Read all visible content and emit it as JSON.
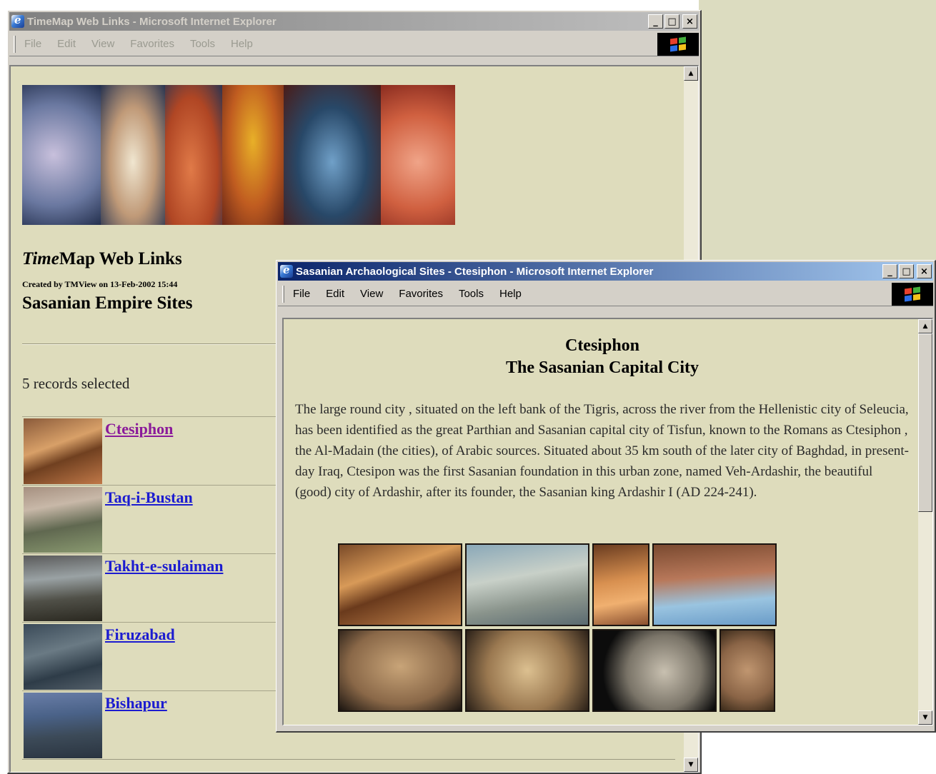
{
  "colors": {
    "page_background": "#dedcbc",
    "link": "#1c1cd0",
    "visited_link": "#8a1a9a",
    "active_title": "#0a246a",
    "inactive_title": "#808080"
  },
  "window_back": {
    "title": "TimeMap Web Links - Microsoft Internet Explorer",
    "menu": [
      "File",
      "Edit",
      "View",
      "Favorites",
      "Tools",
      "Help"
    ],
    "page": {
      "title_italic": "Time",
      "title_rest": "Map Web Links",
      "created": "Created by TMView on 13-Feb-2002 15:44",
      "subtitle": "Sasanian Empire Sites",
      "records": "5 records selected",
      "sites": [
        {
          "name": "Ctesiphon",
          "visited": true
        },
        {
          "name": "Taq-i-Bustan",
          "visited": false
        },
        {
          "name": "Takht-e-sulaiman",
          "visited": false
        },
        {
          "name": "Firuzabad",
          "visited": false
        },
        {
          "name": "Bishapur",
          "visited": false
        }
      ]
    }
  },
  "window_front": {
    "title": "Sasanian Archaological Sites - Ctesiphon - Microsoft Internet Explorer",
    "menu": [
      "File",
      "Edit",
      "View",
      "Favorites",
      "Tools",
      "Help"
    ],
    "page": {
      "heading_line1": "Ctesiphon",
      "heading_line2": "The Sasanian Capital City",
      "body": "The large round city , situated on the left bank of the Tigris, across the river from the Hellenistic city of Seleucia, has been identified as the great Parthian and Sasanian capital city of Tisfun, known to the Romans as Ctesiphon , the Al-Madain (the cities), of Arabic sources. Situated about 35 km south of the later city of Baghdad, in present-day Iraq, Ctesipon was the first Sasanian foundation in this urban zone, named Veh-Ardashir, the beautiful (good) city of Ardashir, after its founder, the Sasanian king Ardashir I (AD 224-241)."
    }
  },
  "window_buttons": {
    "minimize": "_",
    "maximize": "□",
    "close": "×"
  },
  "scroll_arrows": {
    "up": "▲",
    "down": "▼"
  }
}
